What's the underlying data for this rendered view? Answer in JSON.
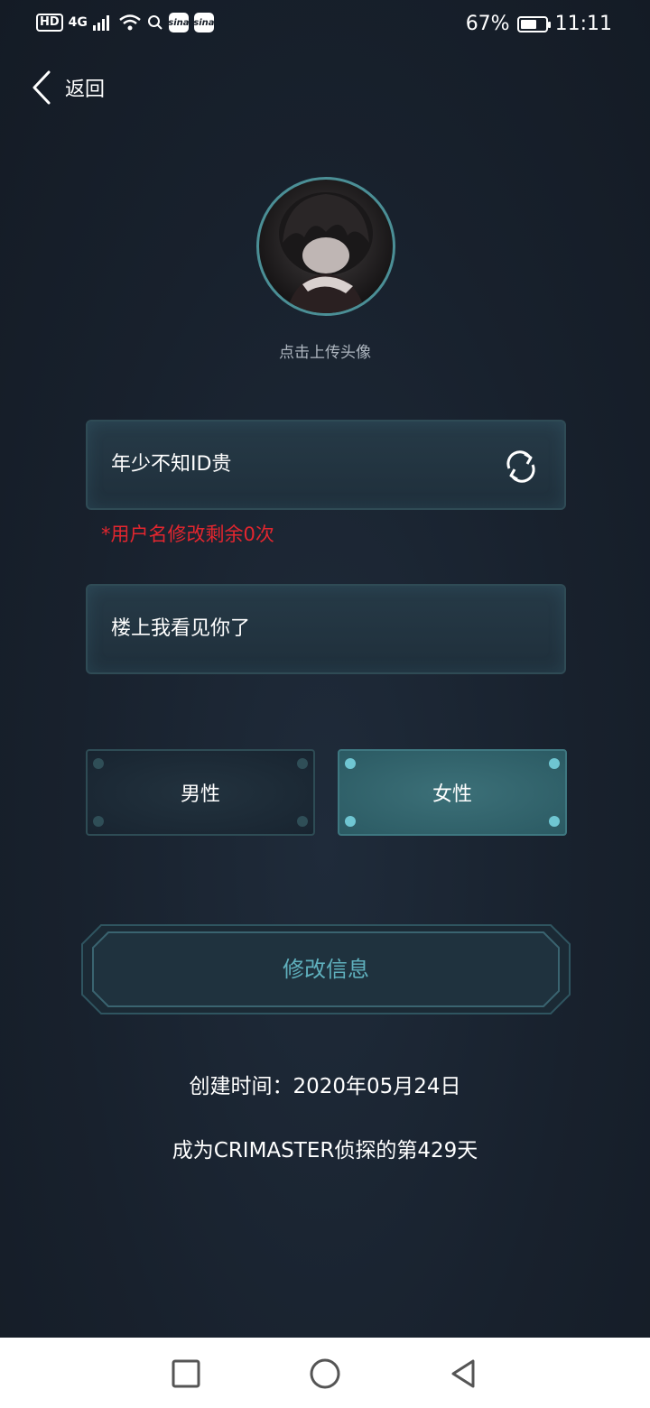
{
  "status_bar": {
    "hd": "HD",
    "network": "4G",
    "battery_text": "67%",
    "battery_level": 0.67,
    "time": "11:11",
    "app_icons": [
      "sina-weibo-icon",
      "sina-weibo-icon"
    ]
  },
  "header": {
    "back_label": "返回"
  },
  "avatar": {
    "caption": "点击上传头像"
  },
  "form": {
    "username_value": "年少不知ID贵",
    "username_hint": "*用户名修改剩余0次",
    "signature_value": "楼上我看见你了",
    "gender": {
      "male_label": "男性",
      "female_label": "女性",
      "selected": "female"
    },
    "submit_label": "修改信息"
  },
  "footer_info": {
    "created": "创建时间：2020年05月24日",
    "days": "成为CRIMASTER侦探的第429天"
  },
  "colors": {
    "accent": "#5fb0bd",
    "warning": "#e3262f",
    "background": "#18212d"
  }
}
